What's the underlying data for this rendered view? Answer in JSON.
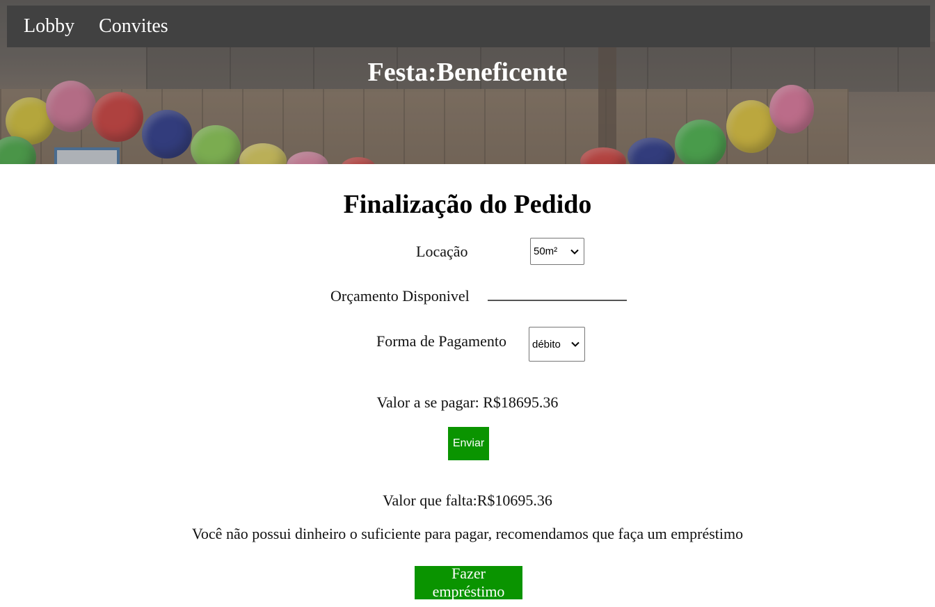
{
  "nav": {
    "items": [
      {
        "label": "Lobby"
      },
      {
        "label": "Convites"
      }
    ]
  },
  "hero": {
    "title": "Festa:Beneficente"
  },
  "form": {
    "heading": "Finalização do Pedido",
    "location": {
      "label": "Locação",
      "selected": "50m²"
    },
    "budget": {
      "label": "Orçamento Disponivel",
      "value": ""
    },
    "payment": {
      "label": "Forma de Pagamento",
      "selected": "débito"
    },
    "amount_to_pay": "Valor a se pagar: R$18695.36",
    "submit_label": "Enviar",
    "amount_missing": "Valor que falta:R$10695.36",
    "warning": "Você não possui dinheiro o suficiente para pagar, recomendamos que faça um empréstimo",
    "loan_label": "Fazer empréstimo"
  },
  "colors": {
    "navbar_bg": "#414141",
    "button_green": "#0a9400"
  },
  "icons": {
    "select_arrow": "chevron-down-icon"
  }
}
